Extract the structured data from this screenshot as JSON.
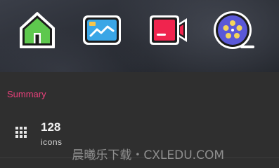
{
  "apps": [
    {
      "icon": "home-icon",
      "color": "#5ec84e"
    },
    {
      "icon": "photo-gallery-icon",
      "color": "#3aa6e6"
    },
    {
      "icon": "video-camera-icon",
      "color": "#f0244e"
    },
    {
      "icon": "film-reel-icon",
      "color": "#5a58d8"
    }
  ],
  "summary": {
    "title": "Summary",
    "count": "128",
    "unit": "icons",
    "accent_color": "#e8407a"
  },
  "watermark": {
    "text": "晨曦乐下载・CXLEDU.COM"
  }
}
